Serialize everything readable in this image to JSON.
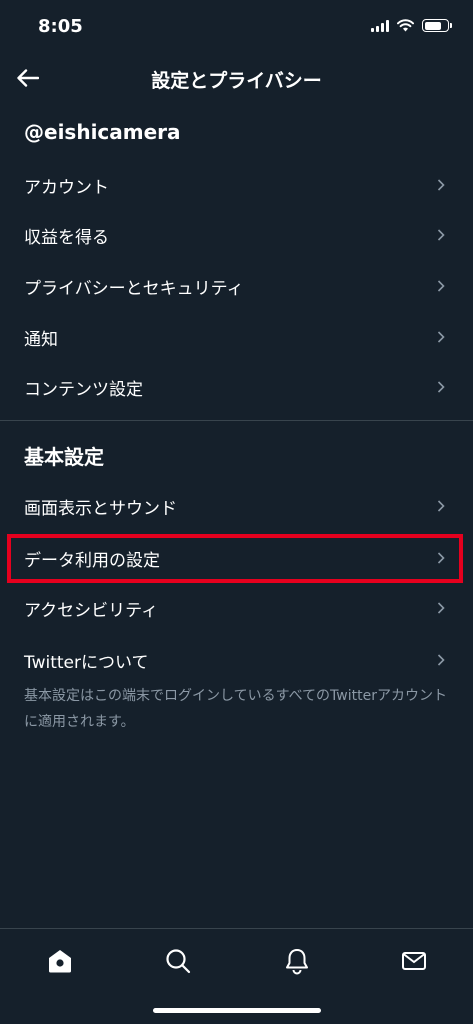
{
  "status_bar": {
    "time": "8:05",
    "battery_level": 0.75
  },
  "header": {
    "title": "設定とプライバシー",
    "back_icon": "arrow-left-icon"
  },
  "account_section": {
    "heading": "@eishicamera",
    "items": [
      {
        "label": "アカウント"
      },
      {
        "label": "収益を得る"
      },
      {
        "label": "プライバシーとセキュリティ"
      },
      {
        "label": "通知"
      },
      {
        "label": "コンテンツ設定"
      }
    ]
  },
  "general_section": {
    "heading": "基本設定",
    "items": [
      {
        "label": "画面表示とサウンド"
      },
      {
        "label": "データ利用の設定",
        "highlighted": true
      },
      {
        "label": "アクセシビリティ"
      },
      {
        "label": "Twitterについて"
      }
    ],
    "footnote": "基本設定はこの端末でログインしているすべてのTwitterアカウントに適用されます。"
  },
  "tab_bar": {
    "tabs": [
      {
        "icon": "home-icon",
        "active": true
      },
      {
        "icon": "search-icon",
        "active": false
      },
      {
        "icon": "bell-icon",
        "active": false
      },
      {
        "icon": "mail-icon",
        "active": false
      }
    ]
  },
  "colors": {
    "background": "#15202b",
    "text": "#ffffff",
    "secondary_text": "#8b98a5",
    "divider": "#38444d",
    "highlight": "#e5001e"
  }
}
